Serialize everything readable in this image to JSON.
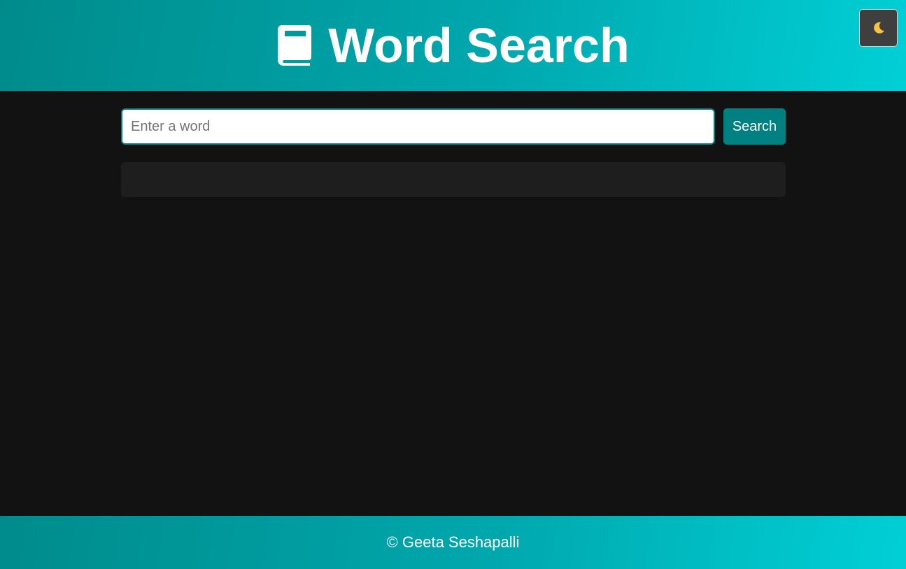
{
  "header": {
    "title": "Word Search",
    "title_icon": "book-icon",
    "theme_toggle_icon": "moon-icon"
  },
  "search": {
    "placeholder": "Enter a word",
    "value": "",
    "button_label": "Search"
  },
  "result": {
    "text": ""
  },
  "footer": {
    "text": "© Geeta Seshapalli"
  },
  "colors": {
    "background": "#121212",
    "accent": "#008080",
    "gradient_start": "#008b8b",
    "gradient_end": "#00d0d6",
    "result_panel": "#1e1e1e",
    "toggle_background": "#3f3f3f",
    "moon": "#f5c542"
  }
}
